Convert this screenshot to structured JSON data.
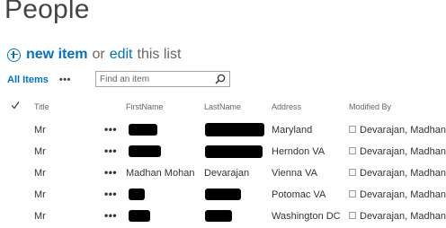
{
  "page": {
    "title": "People"
  },
  "actions": {
    "new_item": "new item",
    "or": "or",
    "edit": "edit",
    "this_list": "this list"
  },
  "views": {
    "current": "All Items",
    "more": "•••"
  },
  "search": {
    "placeholder": "Find an item",
    "value": ""
  },
  "table": {
    "columns": [
      "Title",
      "FirstName",
      "LastName",
      "Address",
      "Modified By"
    ],
    "row_menu": "•••",
    "rows": [
      {
        "title": "Mr",
        "first": "",
        "last": "",
        "address": "Maryland",
        "modified_by": "Devarajan, Madhan"
      },
      {
        "title": "Mr",
        "first": "",
        "last": "",
        "address": "Herndon VA",
        "modified_by": "Devarajan, Madhan"
      },
      {
        "title": "Mr",
        "first": "Madhan Mohan",
        "last": "Devarajan",
        "address": "Vienna VA",
        "modified_by": "Devarajan, Madhan"
      },
      {
        "title": "Mr",
        "first": "",
        "last": "",
        "address": "Potomac VA",
        "modified_by": "Devarajan, Madhan"
      },
      {
        "title": "Mr",
        "first": "",
        "last": "",
        "address": "Washington DC",
        "modified_by": "Devarajan, Madhan"
      }
    ]
  },
  "colors": {
    "accent": "#0072c6",
    "text": "#333333",
    "muted": "#666666",
    "redaction": "#000000"
  },
  "icons": {
    "new_item": "plus-circle-icon",
    "search": "search-icon",
    "select_all": "checkmark-icon",
    "row_checkbox": "checkbox-icon"
  }
}
